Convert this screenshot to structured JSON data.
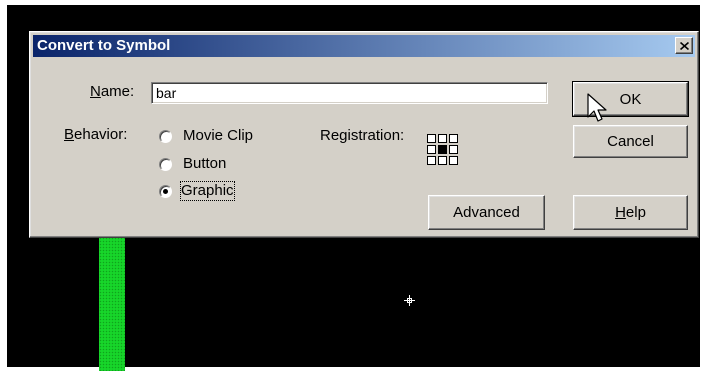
{
  "dialog": {
    "title": "Convert to Symbol",
    "name_label": "Name:",
    "name_value": "bar",
    "behavior_label": "Behavior:",
    "behavior_options": [
      "Movie Clip",
      "Button",
      "Graphic"
    ],
    "behavior_selected": "Graphic",
    "registration_label": "Registration:",
    "registration_selected": "center"
  },
  "buttons": {
    "ok": "OK",
    "cancel": "Cancel",
    "advanced": "Advanced",
    "help": "Help"
  },
  "colors": {
    "title_gradient_start": "#0a246a",
    "title_gradient_end": "#a6caf0",
    "dialog_face": "#d4d0c8",
    "stage_background": "#000000",
    "bar_fill": "#17d62a"
  },
  "icons": [
    "close-icon",
    "registration-grid-icon",
    "crosshair-icon",
    "arrow-cursor-icon"
  ]
}
